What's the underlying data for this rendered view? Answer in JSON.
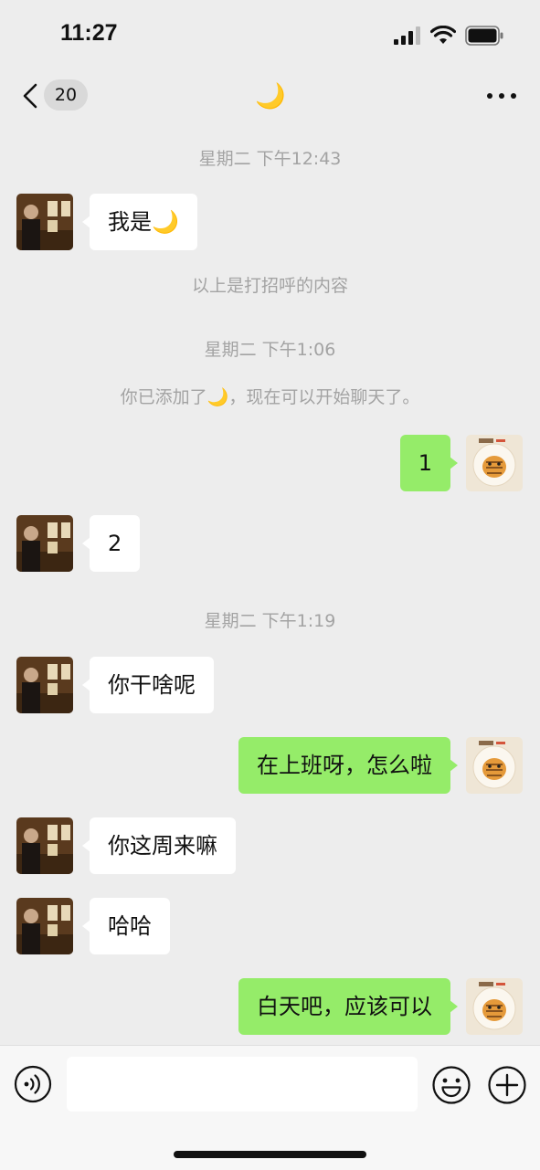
{
  "status_bar": {
    "time": "11:27"
  },
  "nav": {
    "unread_count": "20",
    "title": "🌙"
  },
  "chat": {
    "time_1": "星期二 下午12:43",
    "msg_1": "我是🌙",
    "sys_1": "以上是打招呼的内容",
    "time_2": "星期二 下午1:06",
    "sys_2": "你已添加了🌙，现在可以开始聊天了。",
    "msg_2": "1",
    "msg_3": "2",
    "time_3": "星期二 下午1:19",
    "msg_4": "你干啥呢",
    "msg_5": "在上班呀，怎么啦",
    "msg_6": "你这周来嘛",
    "msg_7": "哈哈",
    "msg_8": "白天吧，应该可以"
  },
  "input": {
    "placeholder": ""
  },
  "colors": {
    "background": "#ededed",
    "self_bubble": "#95ec69",
    "other_bubble": "#ffffff",
    "system_text": "#a3a3a3"
  },
  "icons": {
    "back": "chevron-left-icon",
    "more": "more-dots-icon",
    "voice": "voice-icon",
    "emoji": "smiley-icon",
    "plus": "plus-circle-icon",
    "signal": "cellular-signal-icon",
    "wifi": "wifi-icon",
    "battery": "battery-icon"
  }
}
